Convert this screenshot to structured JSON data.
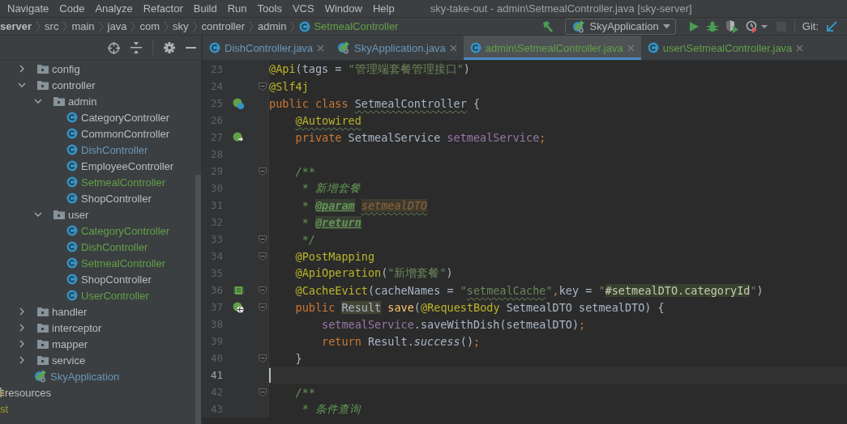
{
  "menu": [
    "Navigate",
    "Code",
    "Analyze",
    "Refactor",
    "Build",
    "Run",
    "Tools",
    "VCS",
    "Window",
    "Help"
  ],
  "title": "sky-take-out - admin\\SetmealController.java [sky-server]",
  "breadcrumb": [
    {
      "label": "server",
      "kind": "module"
    },
    {
      "label": "src",
      "kind": "folder"
    },
    {
      "label": "main",
      "kind": "folder"
    },
    {
      "label": "java",
      "kind": "folder"
    },
    {
      "label": "com",
      "kind": "folder"
    },
    {
      "label": "sky",
      "kind": "folder"
    },
    {
      "label": "controller",
      "kind": "folder"
    },
    {
      "label": "admin",
      "kind": "folder"
    },
    {
      "label": "SetmealController",
      "kind": "class"
    }
  ],
  "toolbar": {
    "run_config": "SkyApplication",
    "git_label": "Git:",
    "actions": [
      {
        "kind": "run",
        "disabled": false
      },
      {
        "kind": "debug",
        "disabled": false
      },
      {
        "kind": "coverage",
        "disabled": false
      },
      {
        "kind": "profile",
        "disabled": false
      },
      {
        "kind": "stop",
        "disabled": true
      }
    ]
  },
  "tree": [
    {
      "label": "config",
      "kind": "folder",
      "color": "#bbbbbb",
      "expanded": false
    },
    {
      "label": "controller",
      "kind": "folder",
      "color": "#bbbbbb",
      "expanded": true,
      "children": [
        {
          "label": "admin",
          "kind": "folder",
          "color": "#bbbbbb",
          "expanded": true,
          "children": [
            {
              "label": "CategoryController",
              "kind": "class",
              "color": "#bbbbbb"
            },
            {
              "label": "CommonController",
              "kind": "class",
              "color": "#bbbbbb"
            },
            {
              "label": "DishController",
              "kind": "class",
              "color": "#6897bb"
            },
            {
              "label": "EmployeeController",
              "kind": "class",
              "color": "#bbbbbb"
            },
            {
              "label": "SetmealController",
              "kind": "class",
              "color": "#62a048"
            },
            {
              "label": "ShopController",
              "kind": "class",
              "color": "#bbbbbb"
            }
          ]
        },
        {
          "label": "user",
          "kind": "folder",
          "color": "#bbbbbb",
          "expanded": true,
          "children": [
            {
              "label": "CategoryController",
              "kind": "class",
              "color": "#62a048"
            },
            {
              "label": "DishController",
              "kind": "class",
              "color": "#62a048"
            },
            {
              "label": "SetmealController",
              "kind": "class",
              "color": "#62a048"
            },
            {
              "label": "ShopController",
              "kind": "class",
              "color": "#bbbbbb"
            },
            {
              "label": "UserController",
              "kind": "class",
              "color": "#62a048"
            }
          ]
        }
      ]
    },
    {
      "label": "handler",
      "kind": "folder",
      "color": "#bbbbbb",
      "expanded": false
    },
    {
      "label": "interceptor",
      "kind": "folder",
      "color": "#bbbbbb",
      "expanded": false
    },
    {
      "label": "mapper",
      "kind": "folder",
      "color": "#bbbbbb",
      "expanded": false
    },
    {
      "label": "service",
      "kind": "folder",
      "color": "#bbbbbb",
      "expanded": false
    },
    {
      "label": "SkyApplication",
      "kind": "app",
      "color": "#6897bb"
    }
  ],
  "tree_outer": [
    {
      "label": "resources",
      "kind": "resources",
      "color": "#bbbbbb"
    },
    {
      "label": "st",
      "kind": "partial",
      "color": "#9f9d2c"
    }
  ],
  "tabs": [
    {
      "label": "DishController.java",
      "kind": "class",
      "color": "#6897bb",
      "selected": false
    },
    {
      "label": "SkyApplication.java",
      "kind": "app",
      "color": "#6897bb",
      "selected": false
    },
    {
      "label": "admin\\SetmealController.java",
      "kind": "class",
      "color": "#62a048",
      "selected": true
    },
    {
      "label": "user\\SetmealController.java",
      "kind": "class",
      "color": "#62a048",
      "selected": false
    }
  ],
  "editor": {
    "lines": [
      {
        "number": "23",
        "fold": false,
        "current": false,
        "tokens": [
          {
            "kind": "ann",
            "t": "@Api"
          },
          {
            "kind": "plain",
            "t": "(tags = "
          },
          {
            "kind": "str",
            "t": "\"管理端套餐管理接口\""
          },
          {
            "kind": "plain",
            "t": ")"
          }
        ]
      },
      {
        "number": "24",
        "fold": true,
        "current": false,
        "tokens": [
          {
            "kind": "ann",
            "t": "@Slf4j"
          }
        ]
      },
      {
        "number": "25",
        "fold": false,
        "current": false,
        "gutter": {
          "kind": "bean"
        },
        "tokens": [
          {
            "kind": "kw",
            "t": "public class "
          },
          {
            "kind": "plain",
            "t": "SetmealController",
            "squiggle": true
          },
          {
            "kind": "plain",
            "t": " {"
          }
        ]
      },
      {
        "number": "26",
        "fold": false,
        "current": false,
        "tokens": [
          {
            "kind": "ann",
            "t": "    @Autowired",
            "squiggle": true
          }
        ]
      },
      {
        "number": "27",
        "fold": false,
        "current": false,
        "gutter": {
          "kind": "autowired"
        },
        "tokens": [
          {
            "kind": "kw",
            "t": "    private "
          },
          {
            "kind": "plain",
            "t": "SetmealService "
          },
          {
            "kind": "field",
            "t": "setmealService"
          },
          {
            "kind": "kw",
            "t": ";"
          }
        ]
      },
      {
        "number": "28",
        "fold": false,
        "current": false
      },
      {
        "number": "29",
        "fold": true,
        "current": false,
        "tokens": [
          {
            "kind": "doc",
            "t": "    /**"
          }
        ]
      },
      {
        "number": "30",
        "fold": false,
        "current": false,
        "tokens": [
          {
            "kind": "doc",
            "t": "     * 新增套餐"
          }
        ]
      },
      {
        "number": "31",
        "fold": false,
        "current": false,
        "tokens": [
          {
            "kind": "doc",
            "t": "     * "
          },
          {
            "kind": "doctag",
            "t": "@param"
          },
          {
            "kind": "docparam",
            "t": " setmealDTO",
            "squiggle": true
          }
        ]
      },
      {
        "number": "32",
        "fold": false,
        "current": false,
        "tokens": [
          {
            "kind": "doc",
            "t": "     * "
          },
          {
            "kind": "doctag",
            "t": "@return"
          }
        ]
      },
      {
        "number": "33",
        "fold": true,
        "current": false,
        "tokens": [
          {
            "kind": "doc",
            "t": "     */"
          }
        ]
      },
      {
        "number": "34",
        "fold": true,
        "current": false,
        "tokens": [
          {
            "kind": "ann",
            "t": "    @PostMapping"
          }
        ]
      },
      {
        "number": "35",
        "fold": false,
        "current": false,
        "tokens": [
          {
            "kind": "ann",
            "t": "    @ApiOperation"
          },
          {
            "kind": "plain",
            "t": "("
          },
          {
            "kind": "str",
            "t": "\"新增套餐\""
          },
          {
            "kind": "plain",
            "t": ")"
          }
        ]
      },
      {
        "number": "36",
        "fold": true,
        "current": false,
        "gutter": {
          "kind": "cache"
        },
        "tokens": [
          {
            "kind": "ann",
            "t": "    @CacheEvict"
          },
          {
            "kind": "plain",
            "t": "(cacheNames = "
          },
          {
            "kind": "str",
            "t": "\""
          },
          {
            "kind": "str",
            "t": "setmealCache",
            "squiggle": true
          },
          {
            "kind": "str",
            "t": "\""
          },
          {
            "kind": "kw",
            "t": ","
          },
          {
            "kind": "plain",
            "t": "key = "
          },
          {
            "kind": "str",
            "t": "\""
          },
          {
            "kind": "spel",
            "t": "#setmealDTO.categoryId"
          },
          {
            "kind": "str",
            "t": "\""
          },
          {
            "kind": "plain",
            "t": ")"
          }
        ]
      },
      {
        "number": "37",
        "fold": true,
        "current": false,
        "gutter": {
          "kind": "web"
        },
        "tokens": [
          {
            "kind": "kw",
            "t": "    public "
          },
          {
            "kind": "hl",
            "t": "Result"
          },
          {
            "kind": "method",
            "t": " save"
          },
          {
            "kind": "plain",
            "t": "("
          },
          {
            "kind": "ann",
            "t": "@RequestBody"
          },
          {
            "kind": "plain",
            "t": " SetmealDTO setmealDTO) {"
          }
        ]
      },
      {
        "number": "38",
        "fold": false,
        "current": false,
        "tokens": [
          {
            "kind": "field",
            "t": "        setmealService"
          },
          {
            "kind": "plain",
            "t": ".saveWithDish(setmealDTO)"
          },
          {
            "kind": "kw",
            "t": ";"
          }
        ]
      },
      {
        "number": "39",
        "fold": false,
        "current": false,
        "tokens": [
          {
            "kind": "kw",
            "t": "        return "
          },
          {
            "kind": "plain",
            "t": "Result."
          },
          {
            "kind": "italic",
            "t": "success"
          },
          {
            "kind": "plain",
            "t": "()"
          },
          {
            "kind": "kw",
            "t": ";"
          }
        ]
      },
      {
        "number": "40",
        "fold": true,
        "current": false,
        "tokens": [
          {
            "kind": "plain",
            "t": "    }"
          }
        ]
      },
      {
        "number": "41",
        "fold": false,
        "current": true
      },
      {
        "number": "42",
        "fold": true,
        "current": false,
        "tokens": [
          {
            "kind": "doc",
            "t": "    /**"
          }
        ]
      },
      {
        "number": "43",
        "fold": false,
        "current": false,
        "tokens": [
          {
            "kind": "doc",
            "t": "     * 条件查询"
          }
        ]
      }
    ]
  }
}
